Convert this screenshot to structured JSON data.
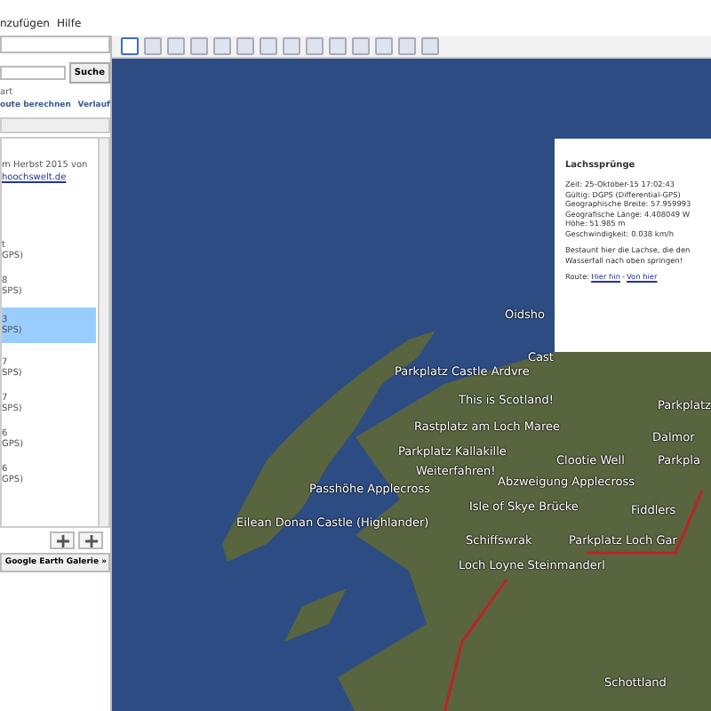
{
  "menu": [
    {
      "label": "nzufügen"
    },
    {
      "label": "Hilfe"
    }
  ],
  "search": {
    "button": "Suche",
    "start": "art",
    "links": [
      "oute berechnen",
      "Verlauf"
    ]
  },
  "places": {
    "description": "m Herbst 2015 von",
    "link": "hoochswelt.de",
    "items": [
      {
        "line1": "t",
        "line2": "GPS)",
        "selected": false
      },
      {
        "line1": "8",
        "line2": "SPS)",
        "selected": false
      },
      {
        "line1": "3",
        "line2": "SPS)",
        "selected": true
      },
      {
        "line1": "7",
        "line2": "SPS)",
        "selected": false
      },
      {
        "line1": "7",
        "line2": "SPS)",
        "selected": false
      },
      {
        "line1": "6",
        "line2": "GPS)",
        "selected": false
      },
      {
        "line1": "6",
        "line2": "GPS)",
        "selected": false
      }
    ]
  },
  "gallery_button": "Google Earth Galerie »",
  "map_labels": [
    {
      "text": "Oidsho"
    },
    {
      "text": "Cast"
    },
    {
      "text": "Parkplatz Castle Ardvre"
    },
    {
      "text": "This is Scotland!"
    },
    {
      "text": "Parkplatz"
    },
    {
      "text": "Rastplatz am Loch Maree"
    },
    {
      "text": "Dalmor"
    },
    {
      "text": "Parkplatz Kallakille"
    },
    {
      "text": "Clootie Well"
    },
    {
      "text": "Parkpla"
    },
    {
      "text": "Weiterfahren!"
    },
    {
      "text": "Abzweigung Applecross"
    },
    {
      "text": "Passhöhe Applecross"
    },
    {
      "text": "Isle of Skye Brücke"
    },
    {
      "text": "Fiddlers"
    },
    {
      "text": "Eilean Donan Castle (Highlander)"
    },
    {
      "text": "Schiffswrak"
    },
    {
      "text": "Parkplatz Loch Gar"
    },
    {
      "text": "Loch Loyne Steinmanderl"
    },
    {
      "text": "Schottland"
    }
  ],
  "balloon": {
    "title": "Lachssprünge",
    "details": [
      "Zeit: 25-Oktober-15 17:02:43",
      "Gültig: DGPS (Differential-GPS)",
      "Geographische Breite: 57.959993",
      "Geografische Länge: 4.408049 W",
      "Höhe: 51.985 m",
      "Geschwindigkeit: 0.038 km/h"
    ],
    "note": "Bestaunt hier die Lachse, die den Wasserfall nach oben springen!",
    "route_label": "Route:",
    "route_links": [
      "Hier hin",
      "Von hier"
    ],
    "separator": "-"
  }
}
